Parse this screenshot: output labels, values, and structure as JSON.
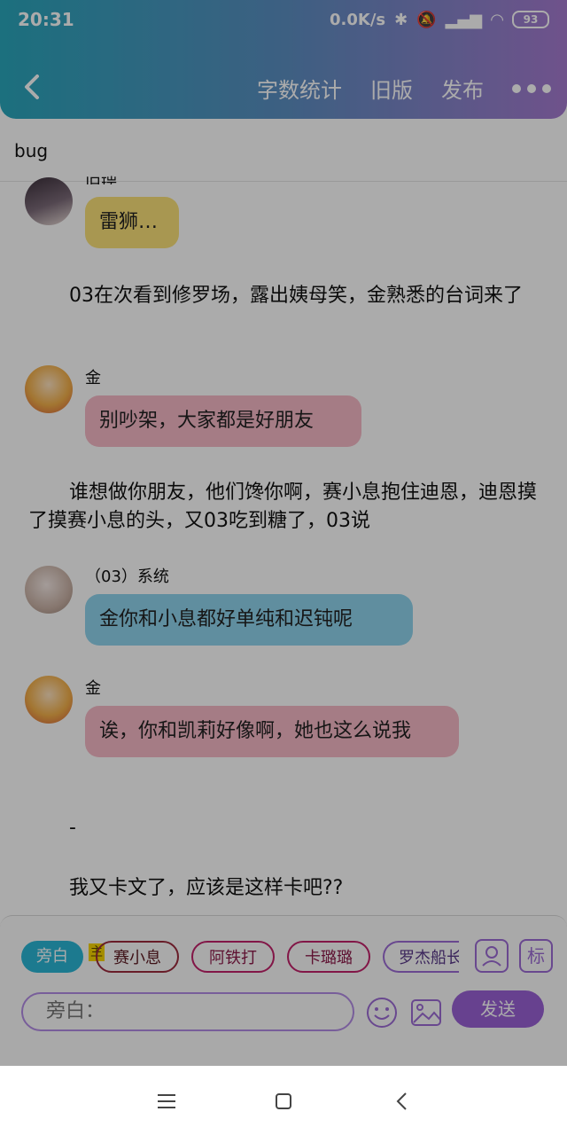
{
  "status": {
    "time": "20:31",
    "speed": "0.0K/s",
    "battery": "93"
  },
  "header": {
    "actions": [
      "字数统计",
      "旧版",
      "发布"
    ]
  },
  "document": {
    "title": "bug"
  },
  "story": {
    "top_name": "旧瑞",
    "top_bubble": "雷狮…",
    "para1": "03在次看到修罗场，露出姨母笑，金熟悉的台词来了",
    "msg1_name": "金",
    "msg1_text": "别吵架，大家都是好朋友",
    "para2": "谁想做你朋友，他们馋你啊，赛小息抱住迪恩，迪恩摸了摸赛小息的头，又03吃到糖了，03说",
    "msg2_name": "（03）系统",
    "msg2_text": "金你和小息都好单纯和迟钝呢",
    "msg3_name": "金",
    "msg3_text": "诶，你和凯莉好像啊，她也这么说我",
    "para3": "-",
    "para4": "我又卡文了，应该是这样卡吧??"
  },
  "composer": {
    "chips": [
      "旁白",
      "赛小息",
      "阿铁打",
      "卡璐璐",
      "罗杰船长"
    ],
    "main_tag": "主",
    "biao": "标",
    "placeholder": "旁白：",
    "send": "发送"
  },
  "colors": {
    "yellow": "#fbe27a",
    "pink": "#f6b9c6",
    "blue": "#8fd4ee",
    "purple": "#9a62d6"
  }
}
